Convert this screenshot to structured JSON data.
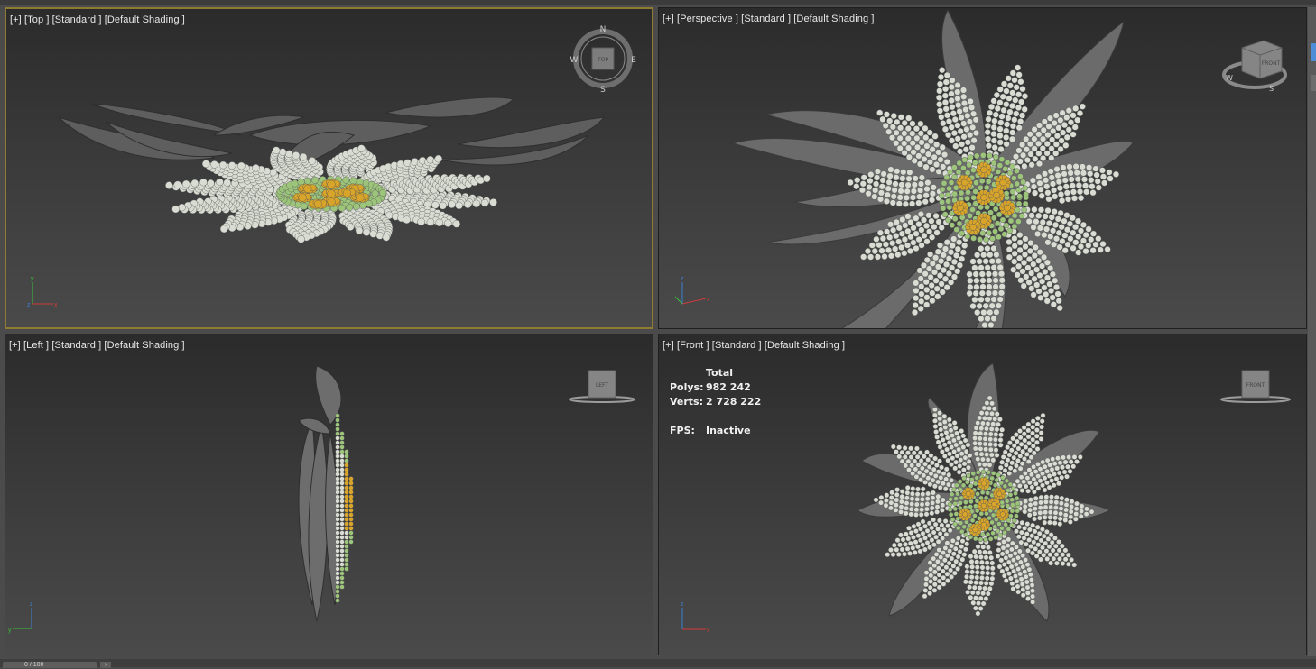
{
  "viewports": [
    {
      "id": "top",
      "label": "[+] [Top ] [Standard ] [Default Shading ]",
      "gizmo_text": "TOP",
      "compass": {
        "n": "N",
        "s": "S",
        "e": "E",
        "w": "W"
      }
    },
    {
      "id": "perspective",
      "label": "[+] [Perspective ] [Standard ] [Default Shading ]",
      "gizmo_text": "FRONT",
      "compass": {
        "w": "W",
        "s": "S"
      }
    },
    {
      "id": "left",
      "label": "[+] [Left ] [Standard ] [Default Shading ]",
      "gizmo_text": "LEFT"
    },
    {
      "id": "front",
      "label": "[+] [Front ] [Standard ] [Default Shading ]",
      "gizmo_text": "FRONT"
    }
  ],
  "stats": {
    "header": "Total",
    "polys_label": "Polys:",
    "polys_value": "982 242",
    "verts_label": "Verts:",
    "verts_value": "2 728 222",
    "fps_label": "FPS:",
    "fps_value": "Inactive"
  },
  "axes": {
    "x": "x",
    "y": "y",
    "z": "z"
  },
  "timeline": {
    "frame": "0 / 100",
    "next": "›"
  },
  "colors": {
    "active_border": "#8f7b34",
    "petal_grey": "#6a6a6a",
    "bead_white": "#d8dcd2",
    "bead_green": "#9cc47a",
    "bead_gold": "#d8a52a"
  },
  "icons": [
    "viewcube-icon",
    "compass-ring-icon",
    "axis-tripod-icon"
  ]
}
